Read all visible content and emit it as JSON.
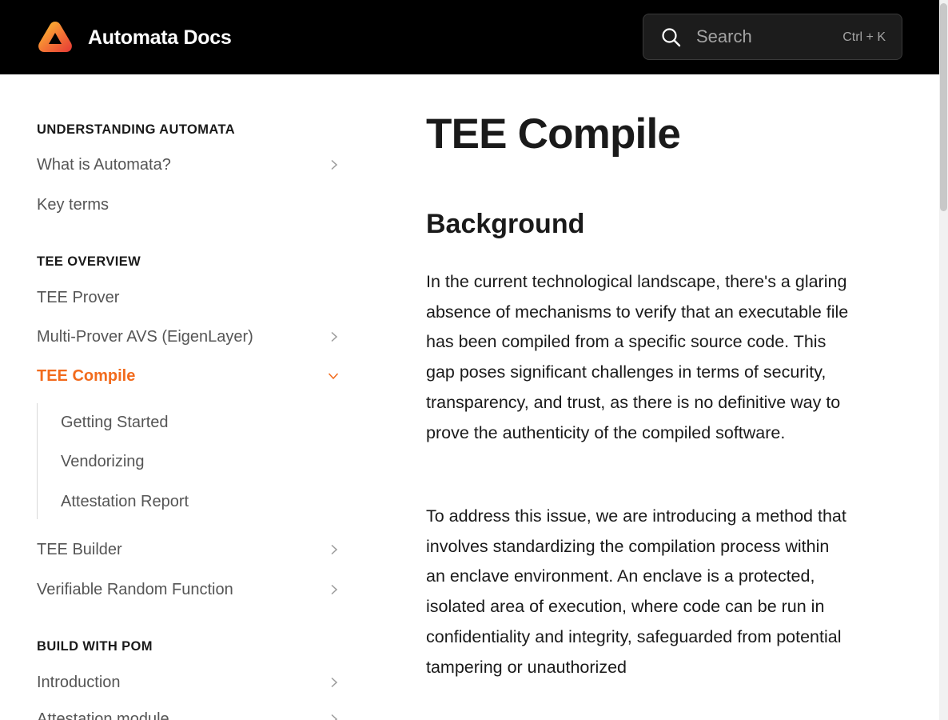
{
  "header": {
    "brand_title": "Automata Docs",
    "logo_colors": [
      "#fdc830",
      "#f37335",
      "#e53935"
    ],
    "search": {
      "placeholder": "Search",
      "shortcut": "Ctrl + K"
    }
  },
  "sidebar": {
    "sections": [
      {
        "heading": "UNDERSTANDING AUTOMATA",
        "items": [
          {
            "label": "What is Automata?",
            "icon": "chevron-right-icon"
          },
          {
            "label": "Key terms"
          }
        ]
      },
      {
        "heading": "TEE OVERVIEW",
        "items": [
          {
            "label": "TEE Prover"
          },
          {
            "label": "Multi-Prover AVS (EigenLayer)",
            "icon": "chevron-right-icon"
          },
          {
            "label": "TEE Compile",
            "icon": "chevron-down-icon",
            "active": true,
            "children": [
              {
                "label": "Getting Started"
              },
              {
                "label": "Vendorizing"
              },
              {
                "label": "Attestation Report"
              }
            ]
          },
          {
            "label": "TEE Builder",
            "icon": "chevron-right-icon"
          },
          {
            "label": "Verifiable Random Function",
            "icon": "chevron-right-icon"
          }
        ]
      },
      {
        "heading": "BUILD WITH POM",
        "items": [
          {
            "label": "Introduction",
            "icon": "chevron-right-icon"
          },
          {
            "label": "Attestation module",
            "icon": "chevron-right-icon"
          }
        ]
      }
    ],
    "active_color": "#f26b1d"
  },
  "main": {
    "title": "TEE Compile",
    "section_title": "Background",
    "paragraphs": [
      "In the current technological landscape, there's a glaring absence of mechanisms to verify that an executable file has been compiled from a specific source code. This gap poses significant challenges in terms of security, transparency, and trust, as there is no definitive way to prove the authenticity of the compiled software.",
      "To address this issue, we are introducing a method that involves standardizing the compilation process within an enclave environment. An enclave is a protected, isolated area of execution, where code can be run in confidentiality and integrity, safeguarded from potential tampering or unauthorized"
    ]
  }
}
